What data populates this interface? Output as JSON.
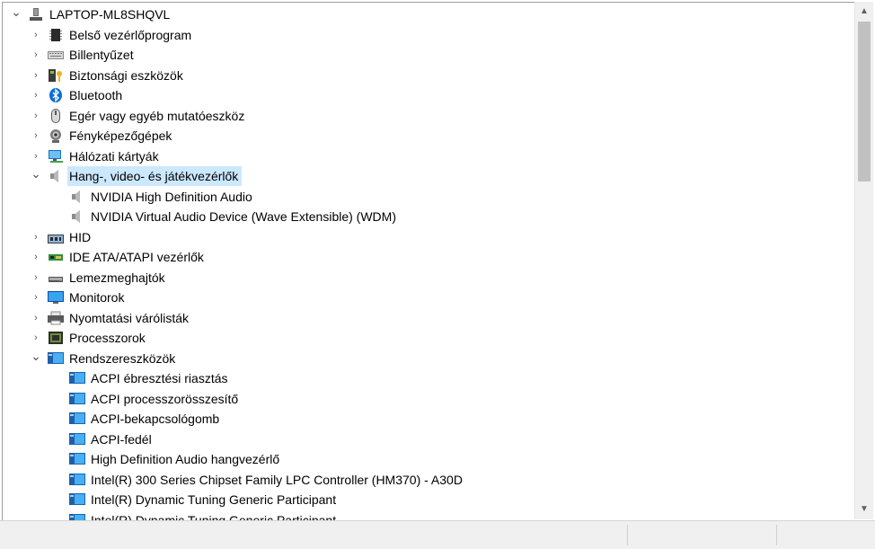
{
  "tree": {
    "root": "LAPTOP-ML8SHQVL",
    "items": [
      {
        "label": "Belső vezérlőprogram",
        "icon": "firmware-chip-icon",
        "expanded": false
      },
      {
        "label": "Billentyűzet",
        "icon": "keyboard-icon",
        "expanded": false
      },
      {
        "label": "Biztonsági eszközök",
        "icon": "security-key-icon",
        "expanded": false
      },
      {
        "label": "Bluetooth",
        "icon": "bluetooth-icon",
        "expanded": false
      },
      {
        "label": "Egér vagy egyéb mutatóeszköz",
        "icon": "mouse-icon",
        "expanded": false
      },
      {
        "label": "Fényképezőgépek",
        "icon": "webcam-icon",
        "expanded": false
      },
      {
        "label": "Hálózati kártyák",
        "icon": "network-adapter-icon",
        "expanded": false
      },
      {
        "label": "Hang-, video- és játékvezérlők",
        "icon": "speaker-icon",
        "expanded": true,
        "selected": true,
        "children": [
          {
            "label": "NVIDIA High Definition Audio",
            "icon": "speaker-icon"
          },
          {
            "label": "NVIDIA Virtual Audio Device (Wave Extensible) (WDM)",
            "icon": "speaker-icon"
          }
        ]
      },
      {
        "label": "HID",
        "icon": "hid-icon",
        "expanded": false
      },
      {
        "label": "IDE ATA/ATAPI vezérlők",
        "icon": "ide-controller-icon",
        "expanded": false
      },
      {
        "label": "Lemezmeghajtók",
        "icon": "disk-drive-icon",
        "expanded": false
      },
      {
        "label": "Monitorok",
        "icon": "monitor-icon",
        "expanded": false
      },
      {
        "label": "Nyomtatási várólisták",
        "icon": "printer-icon",
        "expanded": false
      },
      {
        "label": "Processzorok",
        "icon": "processor-icon",
        "expanded": false
      },
      {
        "label": "Rendszereszközök",
        "icon": "system-device-icon",
        "expanded": true,
        "children": [
          {
            "label": "ACPI ébresztési riasztás",
            "icon": "system-device-icon"
          },
          {
            "label": "ACPI processzorösszesítő",
            "icon": "system-device-icon"
          },
          {
            "label": "ACPI-bekapcsológomb",
            "icon": "system-device-icon"
          },
          {
            "label": "ACPI-fedél",
            "icon": "system-device-icon"
          },
          {
            "label": "High Definition Audio hangvezérlő",
            "icon": "system-device-icon"
          },
          {
            "label": "Intel(R) 300 Series Chipset Family LPC Controller (HM370) - A30D",
            "icon": "system-device-icon"
          },
          {
            "label": "Intel(R) Dynamic Tuning Generic Participant",
            "icon": "system-device-icon"
          },
          {
            "label": "Intel(R) Dynamic Tuning Generic Participant",
            "icon": "system-device-icon"
          }
        ]
      }
    ]
  },
  "scrollbar": {
    "up_arrow": "▲",
    "down_arrow": "▼",
    "position_fraction": 0.0
  }
}
